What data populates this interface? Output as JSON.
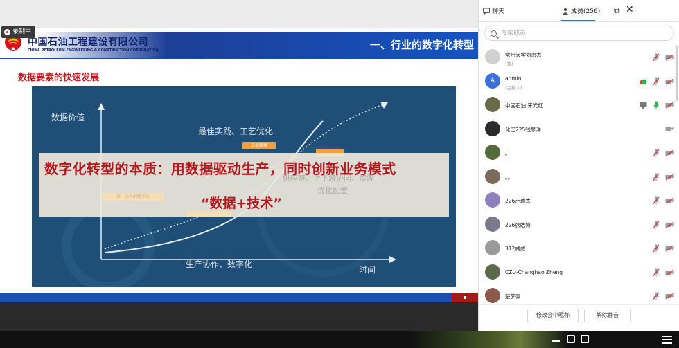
{
  "recording": {
    "label": "录制中"
  },
  "slide": {
    "company_cn": "中国石油工程建设有限公司",
    "company_en": "CHINA PETROLEUM ENGINEERING & CONSTRUCTION CORPORATION",
    "section_title": "一、行业的数字化转型",
    "subheading": "数据要素的快速发展",
    "diagram": {
      "y_axis_label": "数据价值",
      "x_axis_label": "时间",
      "label_top": "最佳实践、工艺优化",
      "tag_top": "工业数据",
      "label_right": "优化配置",
      "label_bottom": "生产协作、数字化",
      "ghost_middle": "供应链、上下游协同、资源",
      "ghost_left": "单一业务的数字化"
    },
    "overlay": {
      "main": "数字化转型的本质：用数据驱动生产，同时创新业务模式",
      "sub": "“数据+技术”"
    }
  },
  "panel": {
    "tabs": [
      {
        "label": "聊天",
        "icon": "chat-icon"
      },
      {
        "label": "成员(256)",
        "icon": "members-icon"
      }
    ],
    "search_placeholder": "搜索成员",
    "members": [
      {
        "name": "常州大学刘恩杰",
        "tag": "(我)",
        "avatar_color": "#d0d0d0",
        "has_cam": true
      },
      {
        "name": "admin",
        "tag": "(主持人)",
        "avatar_color": "#3b6fd9",
        "avatar_letter": "A",
        "has_cam": true,
        "has_cloud": true
      },
      {
        "name": "中国石油 宋光红",
        "tag": "",
        "avatar_color": "#6a6a4a",
        "has_screen": true,
        "mic_active": true,
        "has_cam": true
      },
      {
        "name": "化工225钱思洋",
        "tag": "",
        "avatar_color": "#2a2a2a",
        "has_cam_only": true
      },
      {
        "name": "。",
        "tag": "",
        "avatar_color": "#556b3a",
        "has_cam": true
      },
      {
        "name": "。。",
        "tag": "",
        "avatar_color": "#7a6b5a",
        "has_cam": true
      },
      {
        "name": "226卢瑞杰",
        "tag": "",
        "avatar_color": "#8e7fbf",
        "has_cam": true
      },
      {
        "name": "226张皓博",
        "tag": "",
        "avatar_color": "#7a7a8a",
        "has_cam": true
      },
      {
        "name": "312威威",
        "tag": "",
        "avatar_color": "#9a9a9a",
        "has_cam": true
      },
      {
        "name": "CZU-Changhao Zheng",
        "tag": "",
        "avatar_color": "#5a6a4a",
        "has_cam": true
      },
      {
        "name": "楚梦豪",
        "tag": "",
        "avatar_color": "#8a5a4a",
        "has_cam": true
      }
    ],
    "buttons": {
      "rename": "修改会中昵称",
      "unmute": "解除静音"
    }
  },
  "colors": {
    "accent": "#2b6de0",
    "slide_blue": "#1b4fb1",
    "slide_red": "#c0181e",
    "diagram_bg": "#1f4f77",
    "mic_green": "#2bb34a",
    "muted_red": "#d23a3a"
  }
}
